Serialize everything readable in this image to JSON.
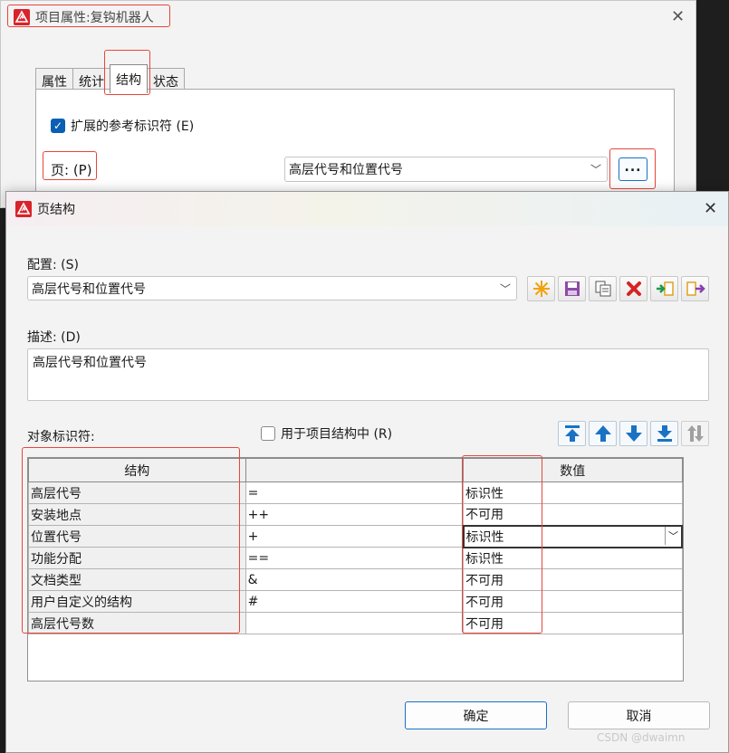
{
  "back_window": {
    "title": "项目属性:复钩机器人",
    "tabs": [
      "属性",
      "统计",
      "结构",
      "状态"
    ],
    "active_tab": "结构",
    "extended_ref_label": "扩展的参考标识符 (E)",
    "extended_ref_checked": true,
    "page_label": "页: (P)",
    "page_value": "高层代号和位置代号",
    "browse_label": "..."
  },
  "dialog": {
    "title": "页结构",
    "config_label": "配置: (S)",
    "config_value": "高层代号和位置代号",
    "toolbar_icons": [
      "new-icon",
      "save-icon",
      "copy-icon",
      "delete-icon",
      "import-icon",
      "export-icon"
    ],
    "desc_label": "描述: (D)",
    "desc_value": "高层代号和位置代号",
    "object_id_label": "对象标识符:",
    "use_in_structure_label": "用于项目结构中 (R)",
    "use_in_structure_checked": false,
    "arrow_icons": [
      "move-top-icon",
      "move-up-icon",
      "move-down-icon",
      "move-bottom-icon",
      "sort-icon"
    ],
    "table": {
      "headers": [
        "结构",
        "",
        "数值"
      ],
      "rows": [
        [
          "高层代号",
          "=",
          "标识性"
        ],
        [
          "安装地点",
          "++",
          "不可用"
        ],
        [
          "位置代号",
          "+",
          "标识性"
        ],
        [
          "功能分配",
          "==",
          "标识性"
        ],
        [
          "文档类型",
          "&",
          "不可用"
        ],
        [
          "用户自定义的结构",
          "#",
          "不可用"
        ],
        [
          "高层代号数",
          "",
          "不可用"
        ]
      ]
    },
    "ok_label": "确定",
    "cancel_label": "取消"
  },
  "watermark": "CSDN @dwaimn",
  "colors": {
    "accent": "#1b6fc4",
    "highlight": "#e8453c"
  }
}
